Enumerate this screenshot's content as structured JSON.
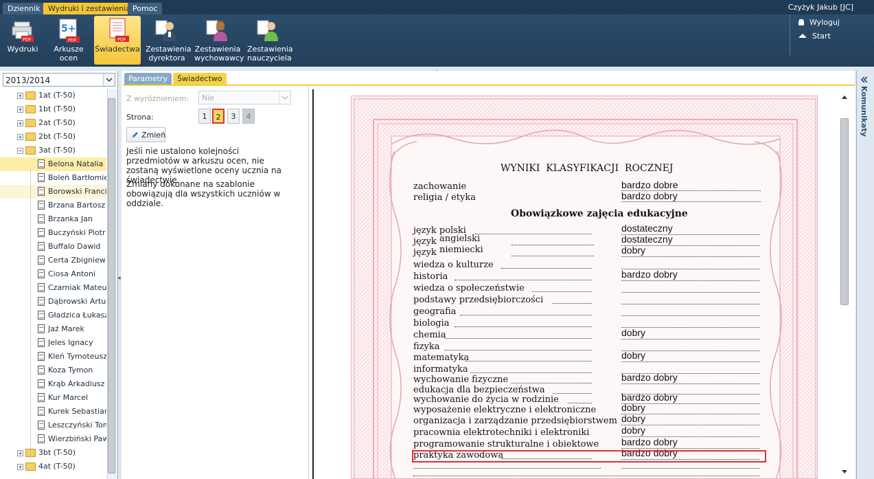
{
  "menu": {
    "tabs": [
      {
        "label": "Dziennik"
      },
      {
        "label": "Wydruki i zestawienia"
      },
      {
        "label": "Pomoc"
      }
    ]
  },
  "user": {
    "name": "Czyżyk Jakub [JC]"
  },
  "ribbon": {
    "buttons": [
      {
        "label": "Wydruki",
        "icon": "printer-pdf-icon"
      },
      {
        "label": "Arkusze\nocen",
        "icon": "grade-pdf-icon"
      },
      {
        "label": "Świadectwa",
        "icon": "certificate-pdf-icon"
      },
      {
        "label": "Zestawienia\ndyrektora",
        "icon": "director-icon"
      },
      {
        "label": "Zestawienia\nwychowawcy",
        "icon": "tutor-icon"
      },
      {
        "label": "Zestawienia\nnauczyciela",
        "icon": "teacher-icon"
      }
    ]
  },
  "right_links": {
    "logout": "Wyloguj",
    "start": "Start"
  },
  "school_year": "2013/2014",
  "tree": {
    "classes_top": [
      {
        "label": "1at (T-50)"
      },
      {
        "label": "1bt (T-50)"
      },
      {
        "label": "2at (T-50)"
      },
      {
        "label": "2bt (T-50)"
      },
      {
        "label": "3at (T-50)"
      }
    ],
    "students": [
      "Belona Natalia",
      "Boleń Bartłomiej",
      "Borowski Franciszek",
      "Brzana Bartosz",
      "Brzanka Jan",
      "Buczyński Piotr",
      "Buffalo Dawid",
      "Certa Zbigniew",
      "Ciosa Antoni",
      "Czarniak Mateusz",
      "Dąbrowski Artur",
      "Gładzica Łukasz",
      "Jaź Marek",
      "Jeles Ignacy",
      "Kleń Tymoteusz",
      "Koza Tymon",
      "Krąb Arkadiusz",
      "Kur Marcel",
      "Kurek Sebastian",
      "Leszczyński Tomasz",
      "Wierzbiński Paweł"
    ],
    "classes_bottom": [
      {
        "label": "3bt (T-50)"
      },
      {
        "label": "4at (T-50)"
      }
    ]
  },
  "tabs": {
    "params": "Parametry",
    "cert": "Świadectwo"
  },
  "form": {
    "distinction_label": "Z wyróżnieniem:",
    "distinction_value": "Nie",
    "page_label": "Strona:",
    "pages": [
      "1",
      "2",
      "3",
      "4"
    ],
    "current_page": "2",
    "change_button": "Zmień",
    "info1": "Jeśli nie ustalono kolejności przedmiotów w arkuszu ocen, nie zostaną wyświetlone oceny ucznia na świadectwie.",
    "info2": "Zmiany dokonane na szablonie obowiązują dla wszystkich uczniów w oddziale."
  },
  "certificate": {
    "title": "WYNIKI  KLASYFIKACJI  ROCZNEJ",
    "behaviour": [
      {
        "name": "zachowanie",
        "grade": "bardzo dobre"
      },
      {
        "name": "religia / etyka",
        "grade": "bardzo dobry"
      }
    ],
    "section": "Obowiązkowe zajęcia edukacyjne",
    "subjects": [
      {
        "name": "język polski",
        "grade": "dostateczny"
      },
      {
        "name": "język",
        "extra": "angielski",
        "grade": "dostateczny"
      },
      {
        "name": "język",
        "extra": "niemiecki",
        "grade": "dobry"
      },
      {
        "name": "wiedza o kulturze",
        "grade": ""
      },
      {
        "name": "historia",
        "grade": "bardzo dobry"
      },
      {
        "name": "wiedza o społeczeństwie",
        "grade": ""
      },
      {
        "name": "podstawy przedsiębiorczości",
        "grade": ""
      },
      {
        "name": "geografia",
        "grade": ""
      },
      {
        "name": "biologia",
        "grade": ""
      },
      {
        "name": "chemia",
        "grade": "dobry"
      },
      {
        "name": "fizyka",
        "grade": ""
      },
      {
        "name": "matematyka",
        "grade": "dobry"
      },
      {
        "name": "informatyka",
        "grade": ""
      },
      {
        "name": "wychowanie fizyczne",
        "grade": "bardzo dobry"
      },
      {
        "name": "edukacja dla bezpieczeństwa",
        "grade": ""
      },
      {
        "name": "wychowanie do życia w rodzinie",
        "grade": "bardzo dobry"
      },
      {
        "name": "wyposażenie elektryczne i elektroniczne",
        "grade": "dobry"
      },
      {
        "name": "organizacja i zarządzanie przedsiębiorstwem",
        "grade": "dobry"
      },
      {
        "name": "pracownia elektrotechniki i elektroniki",
        "grade": "dobry"
      },
      {
        "name": "programowanie strukturalne i obiektowe",
        "grade": "bardzo dobry"
      },
      {
        "name": "praktyka zawodowa",
        "grade": "bardzo dobry"
      }
    ]
  },
  "side_panel": {
    "label": "Komunikaty"
  },
  "colors": {
    "top": "#1f3a55",
    "accent": "#f4c531",
    "highlight_border": "#e03030",
    "cert_border": "#e7b5bb"
  }
}
